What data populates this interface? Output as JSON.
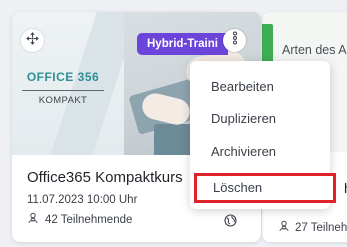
{
  "colors": {
    "badge_bg": "#6b45d9",
    "highlight_border": "#e0232b",
    "logo_text": "#2f8f96",
    "card2_accent": "#3fae52"
  },
  "card": {
    "image_logo_title": "OFFICE 356",
    "image_logo_subtitle": "KOMPAKT",
    "badge": "Hybrid-Traini",
    "title": "Office365 Kompaktkurs",
    "date": "11.07.2023 10:00 Uhr",
    "participants": "42 Teilnehmende",
    "icons": {
      "drag": "drag-move-icon",
      "more": "more-vertical-icon",
      "participants": "participants-icon",
      "globe": "globe-icon"
    }
  },
  "context_menu": {
    "items": [
      {
        "label": "Bearbeiten",
        "highlighted": false
      },
      {
        "label": "Duplizieren",
        "highlighted": false
      },
      {
        "label": "Archivieren",
        "highlighted": false
      },
      {
        "label": "Löschen",
        "highlighted": true
      }
    ]
  },
  "card2": {
    "title": "Arten des A",
    "heading": "h",
    "participants": "27 Teilnehm"
  }
}
